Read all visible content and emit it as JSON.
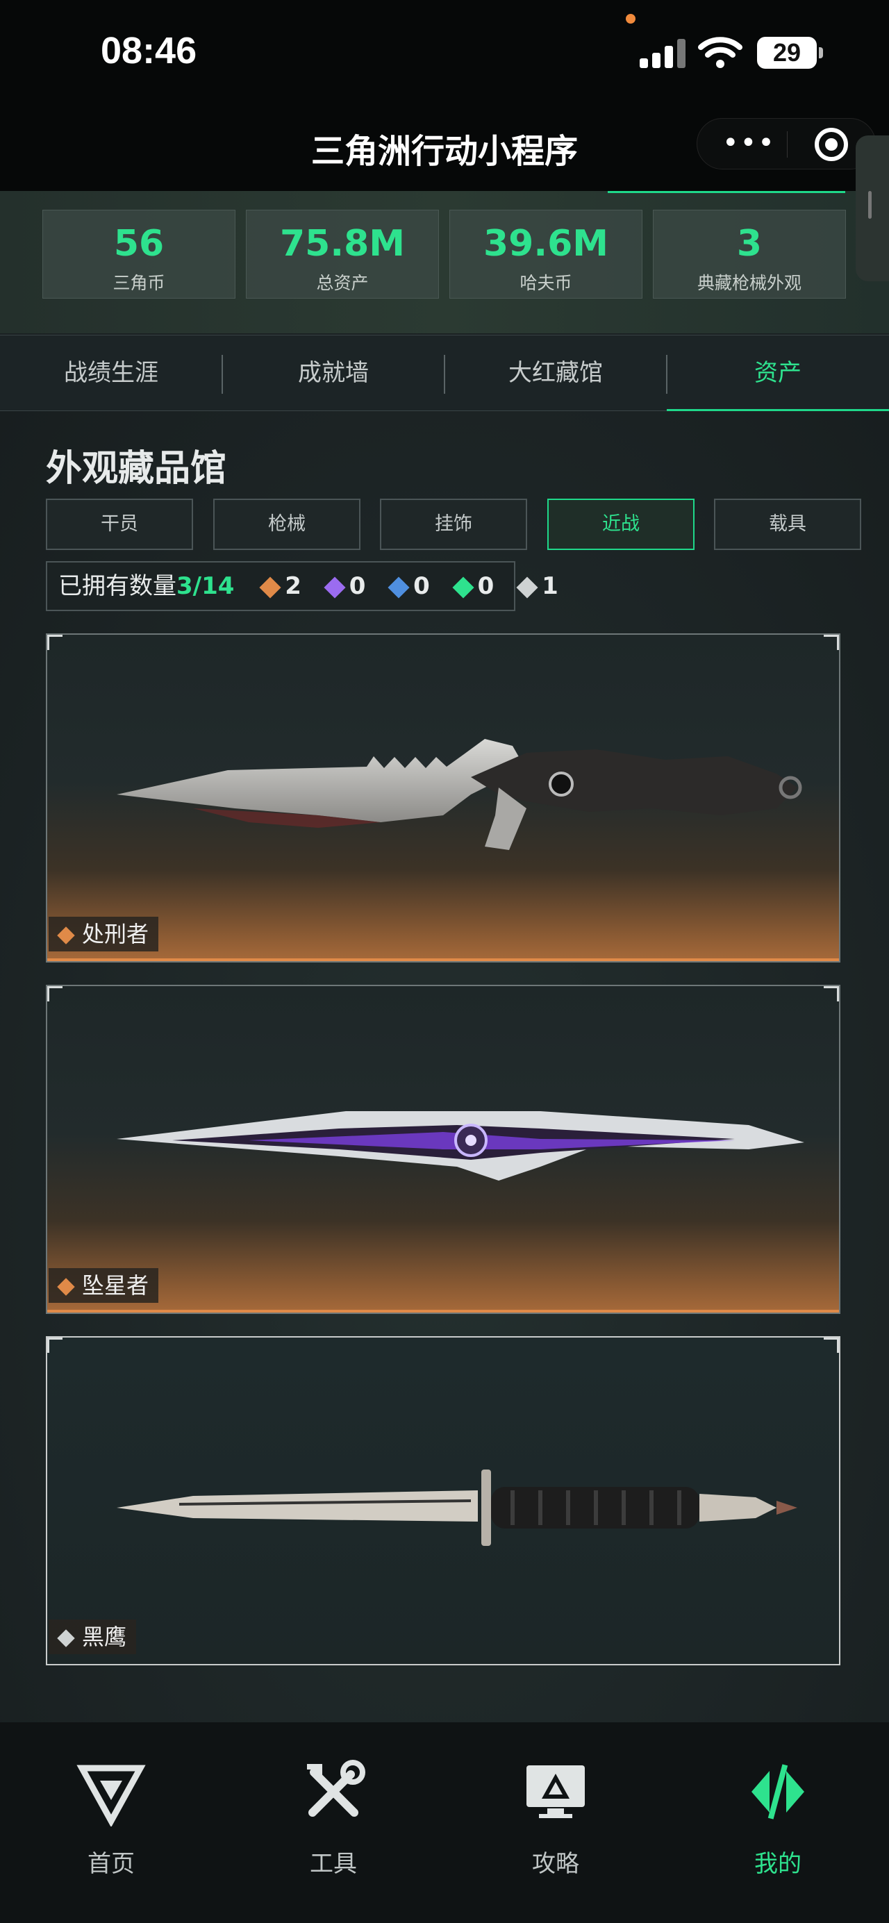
{
  "status_bar": {
    "time": "08:46",
    "battery": "29"
  },
  "nav": {
    "title": "三角洲行动小程序",
    "more": "•••"
  },
  "stats": [
    {
      "value": "56",
      "label": "三角币"
    },
    {
      "value": "75.8M",
      "label": "总资产"
    },
    {
      "value": "39.6M",
      "label": "哈夫币"
    },
    {
      "value": "3",
      "label": "典藏枪械外观"
    }
  ],
  "tabs": [
    "战绩生涯",
    "成就墙",
    "大红藏馆",
    "资产"
  ],
  "active_tab": "资产",
  "section": {
    "title": "外观藏品馆",
    "filters": [
      "干员",
      "枪械",
      "挂饰",
      "近战",
      "载具"
    ],
    "active_filter": "近战",
    "owned": {
      "label": "已拥有数量",
      "count": "3/14",
      "rarities": [
        {
          "color": "#e08a48",
          "count": "2"
        },
        {
          "color": "#9b6cf0",
          "count": "0"
        },
        {
          "color": "#4f8fe0",
          "count": "0"
        },
        {
          "color": "#2ee28e",
          "count": "0"
        },
        {
          "color": "#cfd3d3",
          "count": "1"
        }
      ]
    }
  },
  "items": [
    {
      "name": "处刑者",
      "rarity_color": "#e08a48"
    },
    {
      "name": "坠星者",
      "rarity_color": "#e08a48"
    },
    {
      "name": "黑鹰",
      "rarity_color": "#cfd3d3"
    }
  ],
  "bottom_nav": [
    {
      "label": "首页",
      "icon": "home-logo-icon"
    },
    {
      "label": "工具",
      "icon": "tools-icon"
    },
    {
      "label": "攻略",
      "icon": "guide-monitor-icon"
    },
    {
      "label": "我的",
      "icon": "profile-logo-icon"
    }
  ],
  "colors": {
    "accent": "#2ee28e",
    "legendary": "#e08a48"
  }
}
